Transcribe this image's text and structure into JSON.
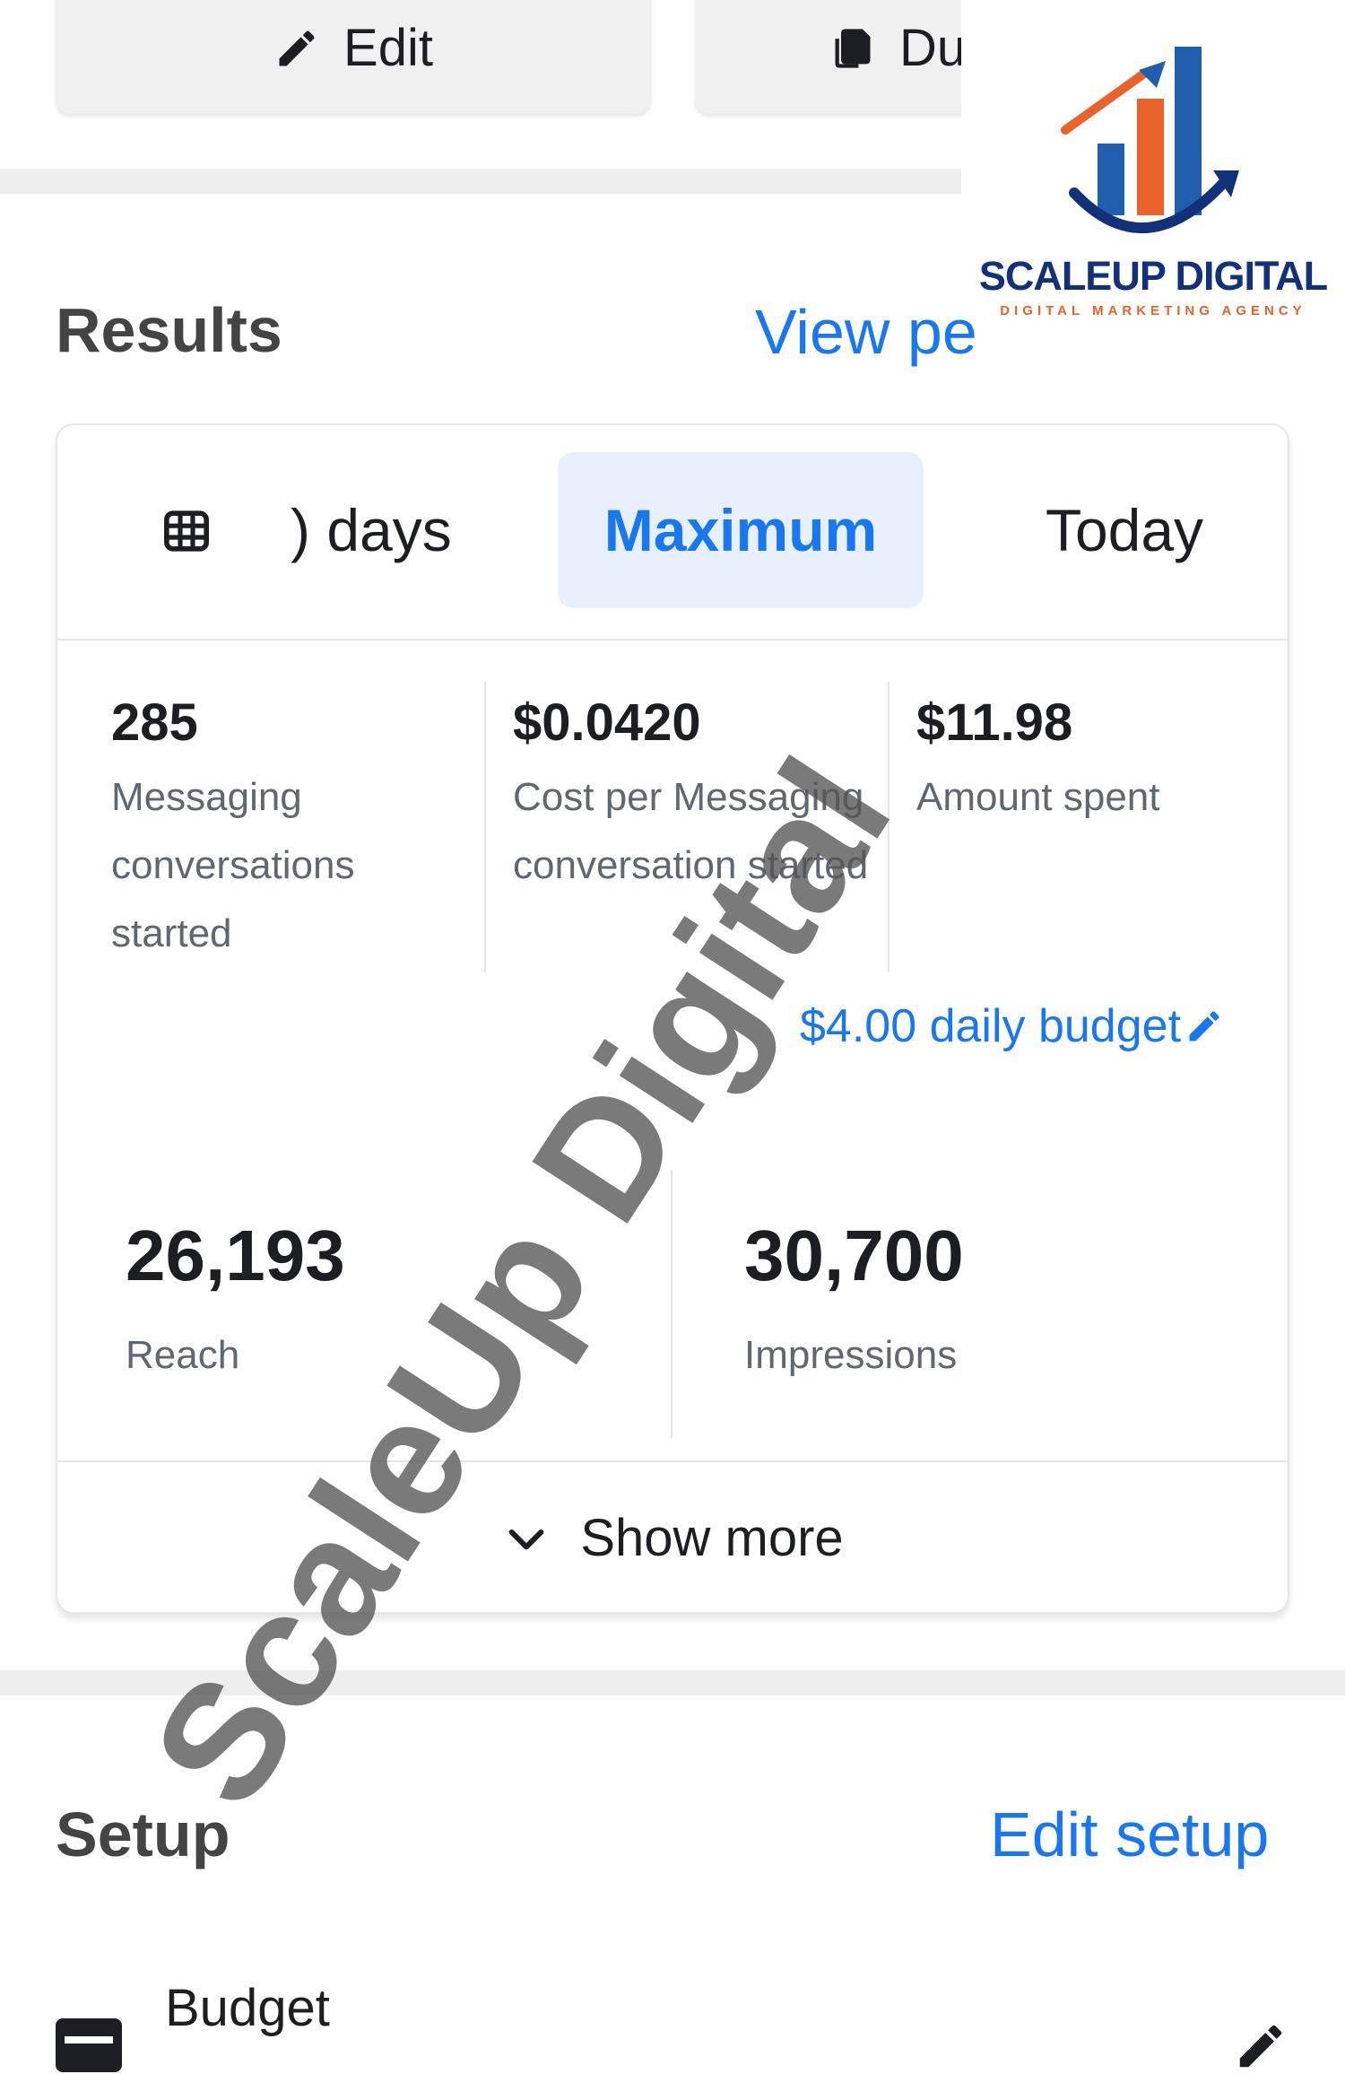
{
  "toolbar": {
    "edit_label": "Edit",
    "duplicate_label": "Du"
  },
  "logo": {
    "name": "SCALEUP DIGITAL",
    "tagline": "DIGITAL MARKETING AGENCY"
  },
  "results": {
    "title": "Results",
    "view_link": "View pe",
    "tabs": [
      {
        "label": ") days",
        "selected": false
      },
      {
        "label": "Maximum",
        "selected": true
      },
      {
        "label": "Today",
        "selected": false
      }
    ],
    "metrics": [
      {
        "value": "285",
        "label": "Messaging conversations started"
      },
      {
        "value": "$0.0420",
        "label": "Cost per Messaging conversation started"
      },
      {
        "value": "$11.98",
        "label": "Amount spent"
      }
    ],
    "budget_link": "$4.00 daily budget",
    "reach": {
      "value": "26,193",
      "label": "Reach"
    },
    "impressions": {
      "value": "30,700",
      "label": "Impressions"
    },
    "show_more": "Show more"
  },
  "watermark": "ScaleUp Digital",
  "setup": {
    "title": "Setup",
    "edit_link": "Edit setup",
    "budget_label": "Budget"
  },
  "colors": {
    "accent": "#1877f2",
    "selected_tab_bg": "#e7f0fc",
    "logo_navy": "#12317a",
    "logo_orange": "#e8622a"
  }
}
